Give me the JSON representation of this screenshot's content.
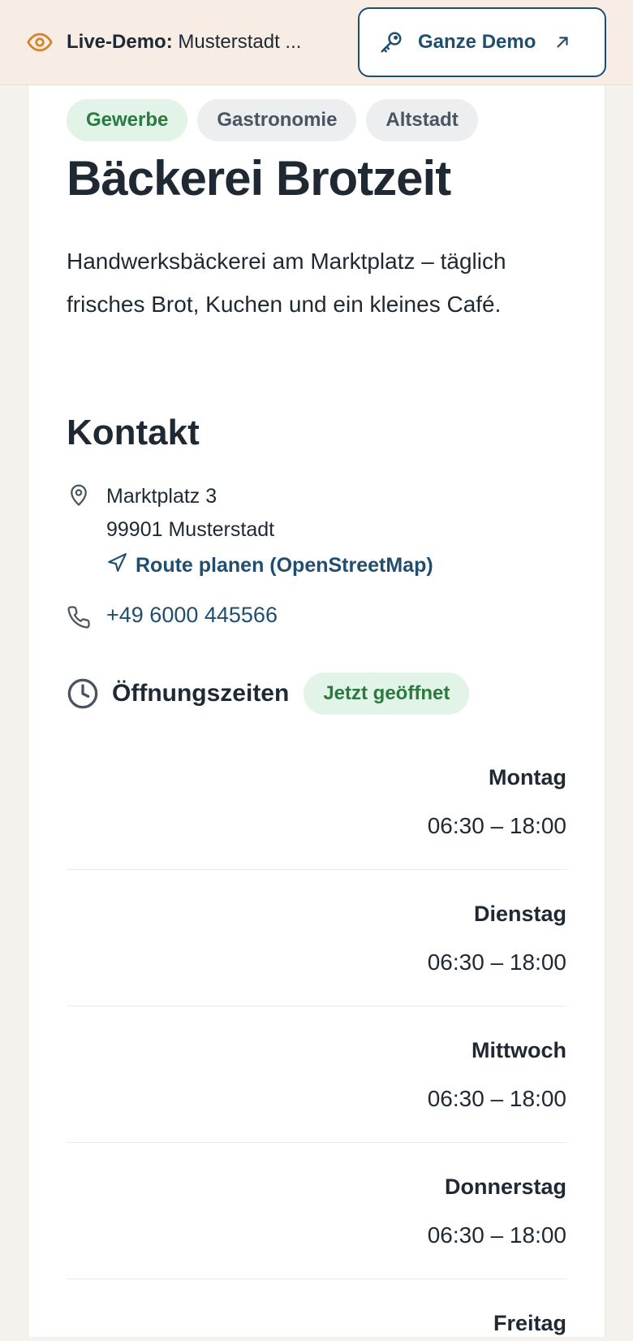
{
  "topbar": {
    "label_bold": "Live-Demo:",
    "label_text": "Musterstadt ...",
    "button_label": "Ganze Demo"
  },
  "tags": [
    "Gewerbe",
    "Gastronomie",
    "Altstadt"
  ],
  "business": {
    "title": "Bäckerei Brotzeit",
    "description": "Handwerksbäckerei am Marktplatz – täglich frisches Brot, Kuchen und ein kleines Café."
  },
  "contact": {
    "heading": "Kontakt",
    "street": "Marktplatz 3",
    "city": "99901 Musterstadt",
    "route_label": "Route planen (OpenStreetMap)",
    "phone": "+49 6000 445566"
  },
  "hours": {
    "heading": "Öffnungszeiten",
    "status": "Jetzt geöffnet",
    "days": [
      {
        "name": "Montag",
        "time": "06:30 – 18:00"
      },
      {
        "name": "Dienstag",
        "time": "06:30 – 18:00"
      },
      {
        "name": "Mittwoch",
        "time": "06:30 – 18:00"
      },
      {
        "name": "Donnerstag",
        "time": "06:30 – 18:00"
      },
      {
        "name": "Freitag",
        "time": ""
      }
    ]
  },
  "colors": {
    "accent": "#1f4e6e",
    "green": "#2b7a3f",
    "eye_icon": "#d4852a"
  }
}
